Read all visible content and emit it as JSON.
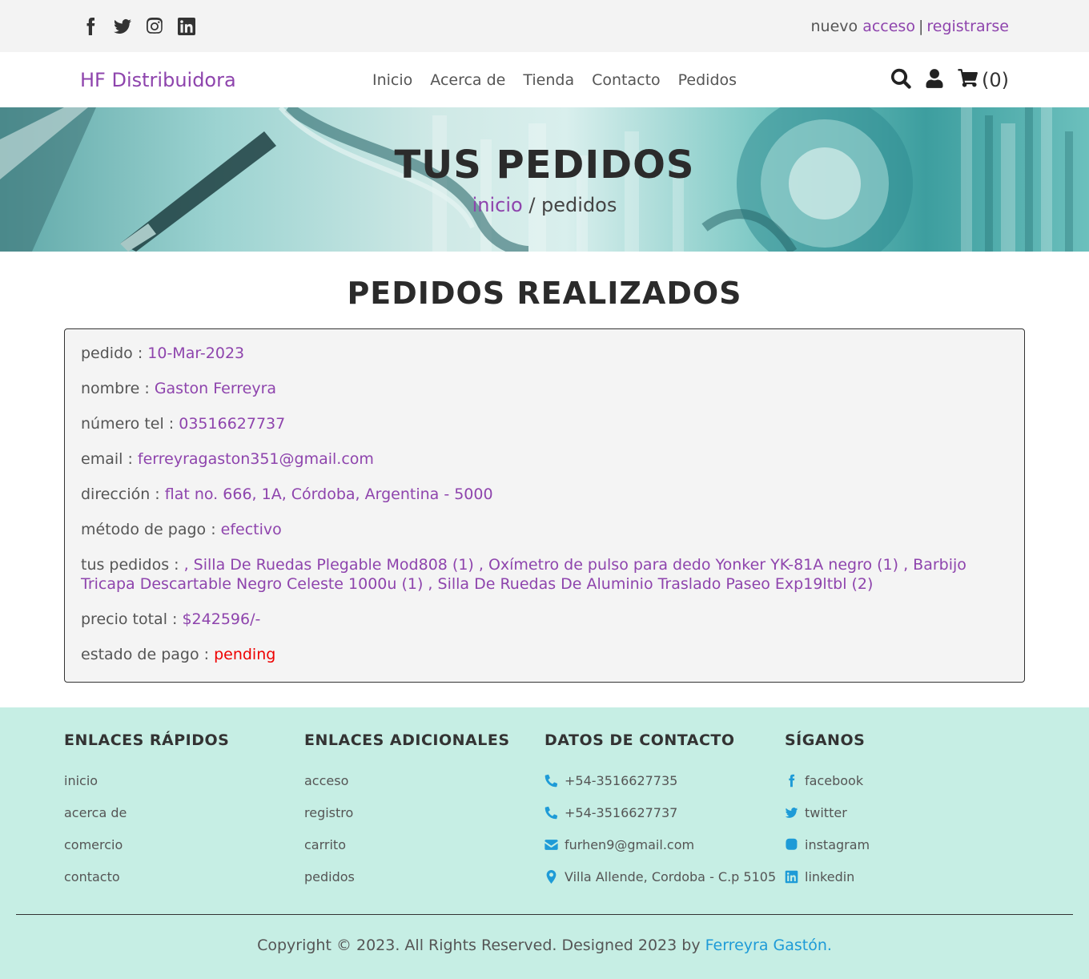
{
  "topbar": {
    "social_icons": [
      "facebook-icon",
      "twitter-icon",
      "instagram-icon",
      "linkedin-icon"
    ],
    "auth_prefix": "nuevo",
    "login_link": "acceso",
    "separator": "|",
    "register_link": "registrarse"
  },
  "nav": {
    "brand": "HF Distribuidora",
    "items": [
      "Inicio",
      "Acerca de",
      "Tienda",
      "Contacto",
      "Pedidos"
    ],
    "cart_count": "(0)",
    "icons": [
      "search-icon",
      "user-icon",
      "cart-icon"
    ]
  },
  "hero": {
    "title": "TUS PEDIDOS",
    "breadcrumb_link": "inicio",
    "breadcrumb_rest": " / pedidos"
  },
  "orders": {
    "title": "PEDIDOS REALIZADOS",
    "order": {
      "fecha_label": "pedido : ",
      "fecha": "10-Mar-2023",
      "nombre_label": "nombre : ",
      "nombre": "Gaston Ferreyra",
      "tel_label": "número tel : ",
      "tel": "03516627737",
      "email_label": "email : ",
      "email": "ferreyragaston351@gmail.com",
      "direccion_label": "dirección : ",
      "direccion": "flat no. 666, 1A, Córdoba, Argentina - 5000",
      "metodo_label": "método de pago : ",
      "metodo": "efectivo",
      "productos_label": "tus pedidos : ",
      "productos": ", Silla De Ruedas Plegable Mod808 (1) , Oxímetro de pulso para dedo Yonker YK-81A negro (1) , Barbijo Tricapa Descartable Negro Celeste 1000u (1) , Silla De Ruedas De Aluminio Traslado Paseo Exp19ltbl (2)",
      "total_label": "precio total : ",
      "total": "$242596/-",
      "estado_label": "estado de pago : ",
      "estado": "pending"
    }
  },
  "footer": {
    "quick": {
      "title": "ENLACES RÁPIDOS",
      "links": [
        "inicio",
        "acerca de",
        "comercio",
        "contacto"
      ]
    },
    "extra": {
      "title": "ENLACES ADICIONALES",
      "links": [
        "acceso",
        "registro",
        "carrito",
        "pedidos"
      ]
    },
    "contact": {
      "title": "DATOS DE CONTACTO",
      "phone1": "+54-3516627735",
      "phone2": "+54-3516627737",
      "email": "furhen9@gmail.com",
      "address": "Villa Allende, Cordoba - C.p 5105"
    },
    "follow": {
      "title": "SÍGANOS",
      "links": [
        "facebook",
        "twitter",
        "instagram",
        "linkedin"
      ]
    },
    "copyright": "Copyright © 2023. All Rights Reserved. Designed 2023 by ",
    "author": "Ferreyra Gastón.",
    "accent_color": "#1e9bd7"
  },
  "colors": {
    "brand": "#8e44ad",
    "status_pending": "#e00000",
    "footer_bg": "#c6eee4"
  }
}
